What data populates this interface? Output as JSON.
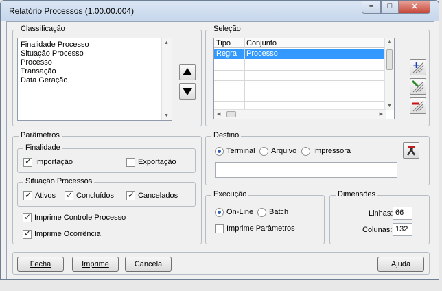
{
  "window": {
    "title": "Relatório Processos (1.00.00.004)"
  },
  "classificacao": {
    "legend": "Classificação",
    "items": [
      "Finalidade Processo",
      "Situação Processo",
      "Processo",
      "Transação",
      "Data Geração"
    ]
  },
  "selecao": {
    "legend": "Seleção",
    "columns": [
      "Tipo",
      "Conjunto"
    ],
    "rows": [
      {
        "tipo": "Regra",
        "conjunto": "Processo"
      }
    ]
  },
  "parametros": {
    "legend": "Parâmetros",
    "finalidade": {
      "legend": "Finalidade",
      "importacao": {
        "label": "Importação",
        "checked": true
      },
      "exportacao": {
        "label": "Exportação",
        "checked": false
      }
    },
    "situacao": {
      "legend": "Situação Processos",
      "ativos": {
        "label": "Ativos",
        "checked": true
      },
      "concluidos": {
        "label": "Concluídos",
        "checked": true
      },
      "cancelados": {
        "label": "Cancelados",
        "checked": true
      }
    },
    "imprime_controle": {
      "label": "Imprime Controle Processo",
      "checked": true
    },
    "imprime_ocorrencia": {
      "label": "Imprime Ocorrência",
      "checked": true
    }
  },
  "destino": {
    "legend": "Destino",
    "options": [
      "Terminal",
      "Arquivo",
      "Impressora"
    ],
    "selected": "Terminal",
    "path_value": ""
  },
  "execucao": {
    "legend": "Execução",
    "options": [
      "On-Line",
      "Batch"
    ],
    "selected": "On-Line",
    "imprime_parametros": {
      "label": "Imprime Parâmetros",
      "checked": false
    }
  },
  "dimensoes": {
    "legend": "Dimensões",
    "linhas_label": "Linhas:",
    "linhas_value": "66",
    "colunas_label": "Colunas:",
    "colunas_value": "132"
  },
  "buttons": {
    "fecha": "Fecha",
    "imprime": "Imprime",
    "cancela": "Cancela",
    "ajuda": "Ajuda"
  },
  "icons": {
    "move_up": "triangle-up-icon",
    "move_down": "triangle-down-icon",
    "add": "add-selection-icon",
    "edit": "edit-selection-icon",
    "remove": "remove-selection-icon",
    "browse": "tools-icon"
  },
  "colors": {
    "selected_row": "#3399ff",
    "accent": "#2a5bb8"
  }
}
